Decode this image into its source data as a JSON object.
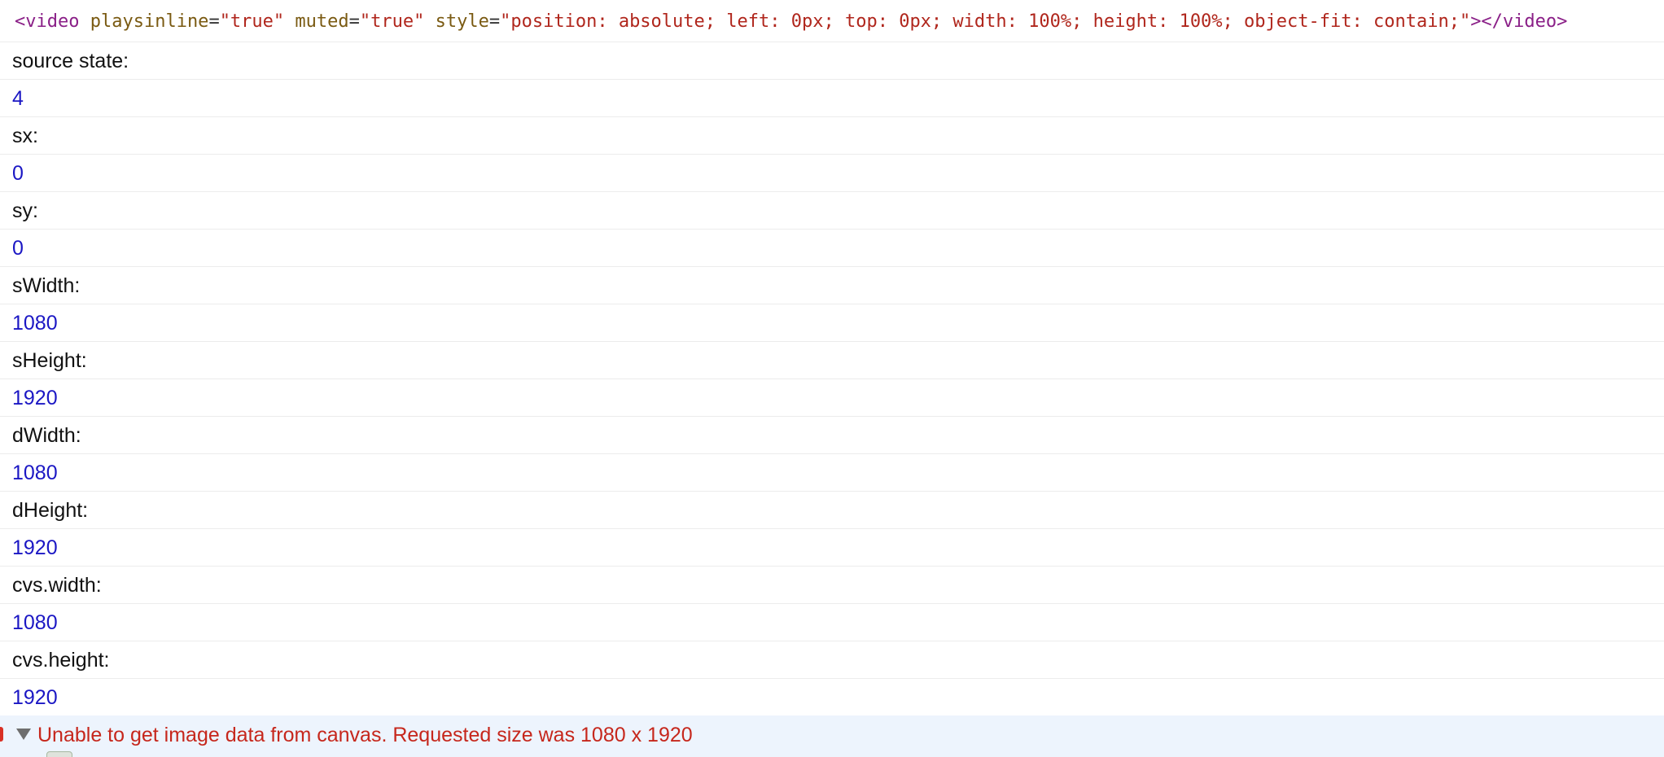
{
  "console": {
    "element_html": {
      "open_tag": "<video",
      "attributes": [
        {
          "name": "playsinline",
          "value": "\"true\""
        },
        {
          "name": "muted",
          "value": "\"true\""
        },
        {
          "name": "style",
          "value": "\"position: absolute; left: 0px; top: 0px; width: 100%; height: 100%; object-fit: contain;\""
        }
      ],
      "close_tag": "></video>"
    },
    "entries": [
      {
        "label": "source state:",
        "value": "4"
      },
      {
        "label": "sx:",
        "value": "0"
      },
      {
        "label": "sy:",
        "value": "0"
      },
      {
        "label": "sWidth:",
        "value": "1080"
      },
      {
        "label": "sHeight:",
        "value": "1920"
      },
      {
        "label": "dWidth:",
        "value": "1080"
      },
      {
        "label": "dHeight:",
        "value": "1920"
      },
      {
        "label": "cvs.width:",
        "value": "1080"
      },
      {
        "label": "cvs.height:",
        "value": "1920"
      }
    ],
    "error": {
      "message": "Unable to get image data from canvas. Requested size was 1080 x 1920",
      "expanded": true
    },
    "colors": {
      "label_text": "#111111",
      "number_value": "#1b17c4",
      "error_text": "#c6271c",
      "error_background": "#edf4fd",
      "html_tag": "#8a1f87",
      "html_attribute": "#7a5a12",
      "html_attribute_value": "#b0261c"
    }
  }
}
